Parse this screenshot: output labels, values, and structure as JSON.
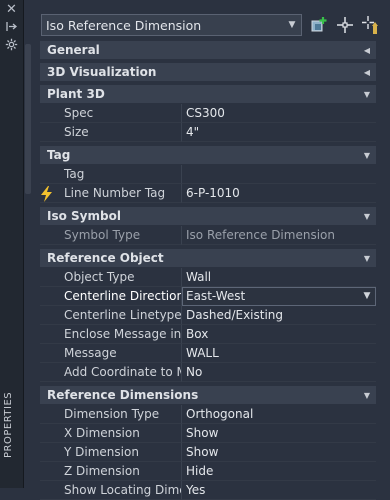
{
  "palette": {
    "title": "PROPERTIES"
  },
  "selector": {
    "value": "Iso Reference Dimension"
  },
  "toolbar": {
    "toggle_icon": "toggle-pickadd-icon",
    "select_icon": "select-objects-icon",
    "quick_icon": "quick-select-icon"
  },
  "categories": {
    "general": "General",
    "viz3d": "3D Visualization",
    "plant3d": "Plant 3D",
    "tag": "Tag",
    "iso_symbol": "Iso Symbol",
    "ref_object": "Reference Object",
    "ref_dims": "Reference Dimensions"
  },
  "plant3d": {
    "spec_label": "Spec",
    "spec_value": "CS300",
    "size_label": "Size",
    "size_value": "4\""
  },
  "tag": {
    "tag_label": "Tag",
    "tag_value": "",
    "line_label": "Line Number Tag",
    "line_value": "6-P-1010"
  },
  "iso_symbol": {
    "type_label": "Symbol Type",
    "type_value": "Iso Reference Dimension"
  },
  "ref_object": {
    "object_type_label": "Object Type",
    "object_type_value": "Wall",
    "centerline_dir_label": "Centerline Direction",
    "centerline_dir_value": "East-West",
    "centerline_lt_label": "Centerline Linetype",
    "centerline_lt_value": "Dashed/Existing",
    "enclose_label": "Enclose Message in",
    "enclose_value": "Box",
    "message_label": "Message",
    "message_value": "WALL",
    "add_coord_label": "Add Coordinate to Mes...",
    "add_coord_value": "No"
  },
  "ref_dims": {
    "dim_type_label": "Dimension Type",
    "dim_type_value": "Orthogonal",
    "x_label": "X Dimension",
    "x_value": "Show",
    "y_label": "Y Dimension",
    "y_value": "Show",
    "z_label": "Z Dimension",
    "z_value": "Hide",
    "locating_label": "Show Locating Dimensi...",
    "locating_value": "Yes"
  }
}
